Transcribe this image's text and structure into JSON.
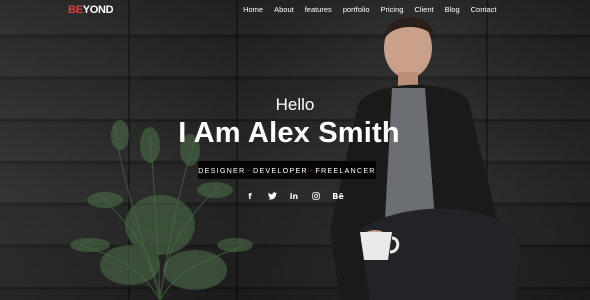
{
  "brand": {
    "logo_accent": "BE",
    "logo_rest": "YOND",
    "accent_color": "#e23a3a"
  },
  "nav": {
    "items": [
      {
        "label": "Home"
      },
      {
        "label": "About"
      },
      {
        "label": "features"
      },
      {
        "label": "portfolio"
      },
      {
        "label": "Pricing"
      },
      {
        "label": "Client"
      },
      {
        "label": "Blog"
      },
      {
        "label": "Contact"
      }
    ]
  },
  "hero": {
    "greeting": "Hello",
    "headline": "I Am Alex Smith",
    "roles": [
      "DESIGNER",
      "DEVELOPER",
      "FREELANCER"
    ],
    "role_separator": "-"
  },
  "social": [
    {
      "icon": "facebook-icon",
      "glyph": "f"
    },
    {
      "icon": "twitter-icon",
      "glyph": "t"
    },
    {
      "icon": "linkedin-icon",
      "glyph": "in"
    },
    {
      "icon": "instagram-icon",
      "glyph": "ig"
    },
    {
      "icon": "behance-icon",
      "glyph": "Bē"
    }
  ]
}
